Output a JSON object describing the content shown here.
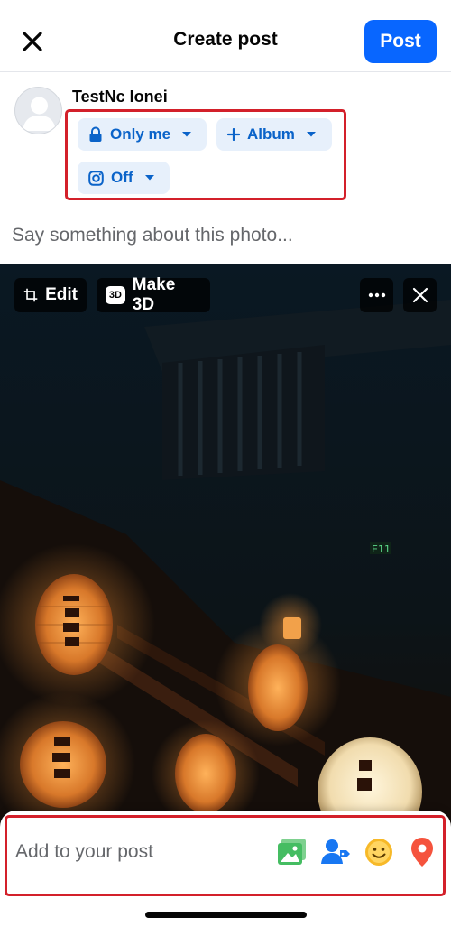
{
  "header": {
    "title": "Create post",
    "post_label": "Post",
    "close_icon": "close-icon"
  },
  "user": {
    "name": "TestNc Ionei",
    "avatar_icon": "person-icon"
  },
  "audience": {
    "privacy_label": "Only me",
    "privacy_icon": "lock-icon",
    "album_label": "Album",
    "album_icon": "plus-icon",
    "instagram_label": "Off",
    "instagram_icon": "instagram-icon"
  },
  "composer": {
    "placeholder": "Say something about this photo..."
  },
  "photo_toolbar": {
    "edit_label": "Edit",
    "make3d_label": "Make 3D",
    "make3d_badge": "3D",
    "more_icon": "more-horizontal-icon",
    "remove_icon": "close-icon"
  },
  "add_to_post": {
    "label": "Add to your post",
    "icons": [
      "photo-video-icon",
      "tag-people-icon",
      "feeling-icon",
      "location-pin-icon"
    ]
  },
  "colors": {
    "accent": "#0866ff",
    "chip_bg": "#e7f0fb",
    "chip_text": "#0a63c9",
    "highlight": "#d3202a",
    "photo_green": "#45bd62",
    "tag_blue": "#1877f2",
    "feeling_yellow": "#f7b928",
    "location_red": "#f5533d"
  }
}
